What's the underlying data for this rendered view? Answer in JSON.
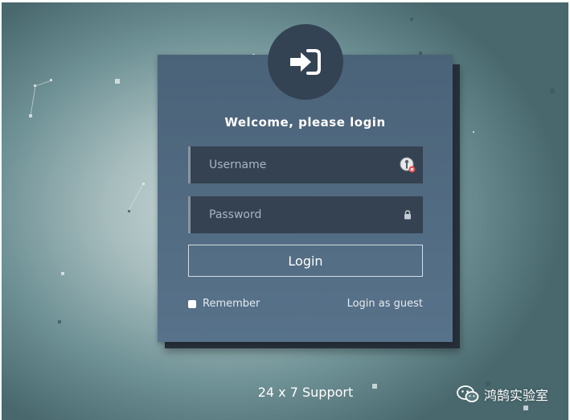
{
  "login_form": {
    "heading": "Welcome, please login",
    "username": {
      "placeholder": "Username",
      "value": ""
    },
    "password": {
      "placeholder": "Password",
      "value": ""
    },
    "submit_label": "Login",
    "remember_label": "Remember",
    "remember_checked": false,
    "guest_link": "Login as guest"
  },
  "footer": {
    "support_text": "24 x 7 Support"
  },
  "watermark": {
    "text": "鸿鹄实验室"
  },
  "icons": {
    "badge": "sign-in-icon",
    "username_field": "key-icon",
    "password_field": "lock-icon",
    "watermark": "wechat-icon"
  },
  "colors": {
    "card": "#526c83",
    "badge": "#344354",
    "field": "#344252",
    "accent_error": "#e0484a"
  }
}
